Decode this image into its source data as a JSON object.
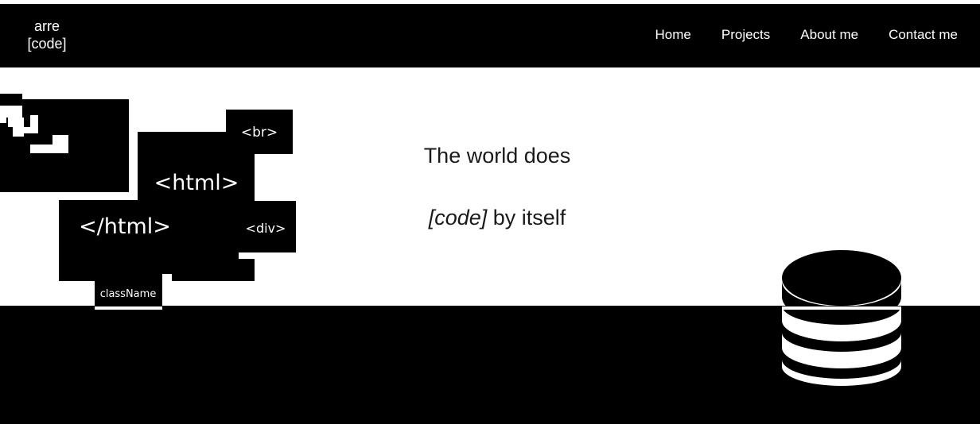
{
  "brand": {
    "line1": "arre",
    "line2": "[code]"
  },
  "nav": {
    "items": [
      "Home",
      "Projects",
      "About me",
      "Contact me"
    ]
  },
  "illustration": {
    "tags": {
      "br": "<br>",
      "html_open": "<html>",
      "html_close": "</html>",
      "div": "<div>",
      "classname": "className"
    }
  },
  "hero": {
    "line1": "The world does",
    "code_word": "[code]",
    "line2_rest": " by itself"
  },
  "icons": {
    "illustration": "code-blocks-illustration",
    "database": "database-icon"
  },
  "colors": {
    "background": "#ffffff",
    "dark": "#000000",
    "text": "#1a1a1a"
  }
}
